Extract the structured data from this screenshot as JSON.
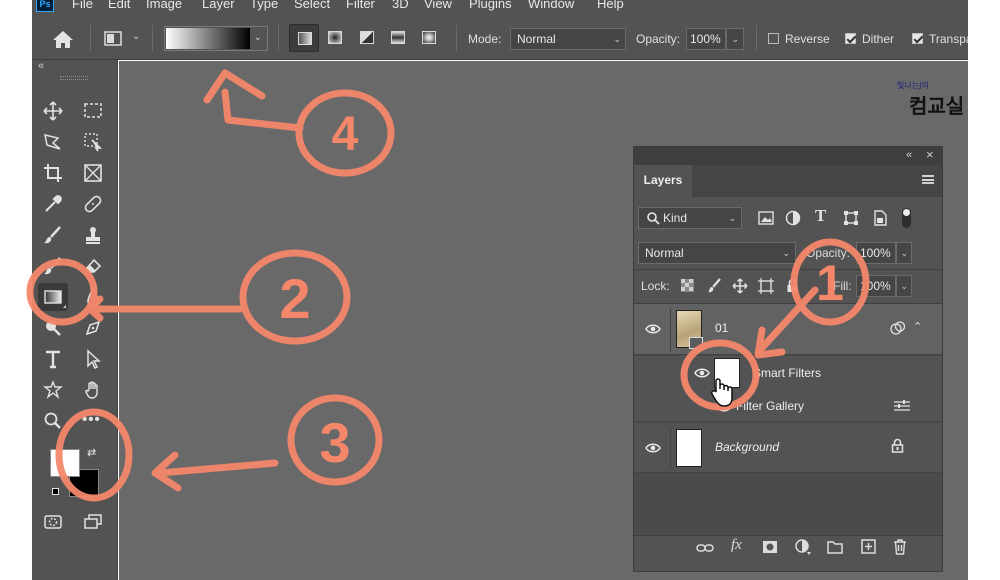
{
  "menubar": {
    "logo": "Ps",
    "items": [
      "File",
      "Edit",
      "Image",
      "Layer",
      "Type",
      "Select",
      "Filter",
      "3D",
      "View",
      "Plugins",
      "Window",
      "Help"
    ]
  },
  "options": {
    "mode_label": "Mode:",
    "mode_value": "Normal",
    "opacity_label": "Opacity:",
    "opacity_value": "100%",
    "reverse_label": "Reverse",
    "dither_label": "Dither",
    "transparency_label": "Transpa",
    "reverse_checked": false,
    "dither_checked": true,
    "transparency_checked": true
  },
  "toolbar": {
    "collapse": "«",
    "more": "•••",
    "swap": "⇄"
  },
  "watermark": {
    "small": "빛나는J의",
    "big": "컴교실"
  },
  "layers_panel": {
    "collapse": "«",
    "close": "×",
    "tab_label": "Layers",
    "kind_label": "Kind",
    "blend_mode": "Normal",
    "opacity_label": "Opacity:",
    "opacity_value": "100%",
    "lock_label": "Lock:",
    "fill_label": "Fill:",
    "fill_value": "100%",
    "layers": [
      {
        "name": "01"
      },
      {
        "name": "Smart Filters"
      },
      {
        "name": "Filter Gallery"
      },
      {
        "name": "Background"
      }
    ]
  },
  "annotations": {
    "num1": "1",
    "num2": "2",
    "num3": "3",
    "num4": "4"
  },
  "colors": {
    "ui_dark": "#535353",
    "canvas": "#696969",
    "annotation": "#f4876a",
    "ps_blue": "#31a8ff"
  }
}
